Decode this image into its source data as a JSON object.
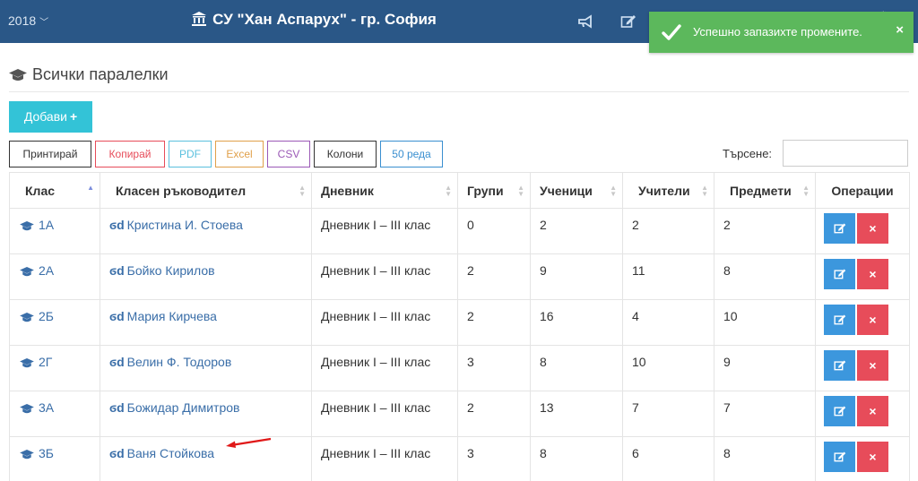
{
  "header": {
    "year": "2018",
    "school_name": "СУ \"Хан Аспарух\" - гр. София",
    "icons": [
      "megaphone-icon",
      "edit-icon",
      "notification-icon",
      "user-icon",
      "settings-icon"
    ],
    "bg_color": "#2a5787"
  },
  "toast": {
    "message": "Успешно запазихте промените.",
    "close": "×",
    "color": "#5cb85c"
  },
  "page": {
    "title": "Всички паралелки",
    "add_button": "Добави",
    "add_icon": "+"
  },
  "export_buttons": [
    {
      "label": "Принтирай",
      "color": "#333333"
    },
    {
      "label": "Копирай",
      "color": "#e74c5a"
    },
    {
      "label": "PDF",
      "color": "#5bc0de"
    },
    {
      "label": "Excel",
      "color": "#e0a04a"
    },
    {
      "label": "CSV",
      "color": "#9b59b6"
    },
    {
      "label": "Колони",
      "color": "#333333"
    },
    {
      "label": "50 реда",
      "color": "#3a8fd0"
    }
  ],
  "search": {
    "label": "Търсене:",
    "value": ""
  },
  "table": {
    "columns": [
      "Клас",
      "Класен ръководител",
      "Дневник",
      "Групи",
      "Ученици",
      "Учители",
      "Предмети",
      "Операции"
    ],
    "rows": [
      {
        "class": "1А",
        "teacher": "Кристина И. Стоева",
        "journal": "Дневник I – III клас",
        "groups": "0",
        "students": "2",
        "teachers": "2",
        "subjects": "2"
      },
      {
        "class": "2А",
        "teacher": "Бойко Кирилов",
        "journal": "Дневник I – III клас",
        "groups": "2",
        "students": "9",
        "teachers": "11",
        "subjects": "8"
      },
      {
        "class": "2Б",
        "teacher": "Мария Кирчева",
        "journal": "Дневник I – III клас",
        "groups": "2",
        "students": "16",
        "teachers": "4",
        "subjects": "10"
      },
      {
        "class": "2Г",
        "teacher": "Велин Ф. Тодоров",
        "journal": "Дневник I – III клас",
        "groups": "3",
        "students": "8",
        "teachers": "10",
        "subjects": "9"
      },
      {
        "class": "3А",
        "teacher": "Божидар Димитров",
        "journal": "Дневник I – III клас",
        "groups": "2",
        "students": "13",
        "teachers": "7",
        "subjects": "7"
      },
      {
        "class": "3Б",
        "teacher": "Ваня Стойкова",
        "journal": "Дневник I – III клас",
        "groups": "3",
        "students": "8",
        "teachers": "6",
        "subjects": "8"
      }
    ],
    "edit_icon": "edit-icon",
    "delete_icon": "×"
  }
}
